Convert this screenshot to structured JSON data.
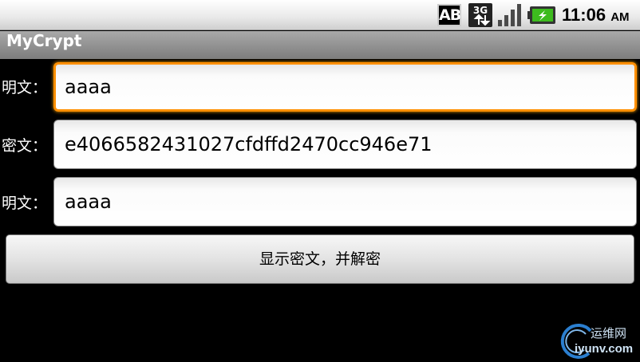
{
  "status_bar": {
    "ab_badge": "AB",
    "network_badge": "3G",
    "time": "11:06",
    "ampm": "AM",
    "icons": [
      "ab-badge-icon",
      "network-3g-icon",
      "signal-strength-icon",
      "battery-charging-icon"
    ],
    "battery_color": "#3dbb1e"
  },
  "app": {
    "title": "MyCrypt"
  },
  "form": {
    "plaintext_label": "明文：",
    "plaintext_value": "aaaa",
    "ciphertext_label": "密文：",
    "ciphertext_value": "e4066582431027cfdffd2470cc946e71",
    "decrypted_label": "明文：",
    "decrypted_value": "aaaa",
    "focus_color": "#ff8f00"
  },
  "button": {
    "label": "显示密文，并解密"
  },
  "watermark": {
    "top": "运维网",
    "bottom": "iyunv.com"
  }
}
